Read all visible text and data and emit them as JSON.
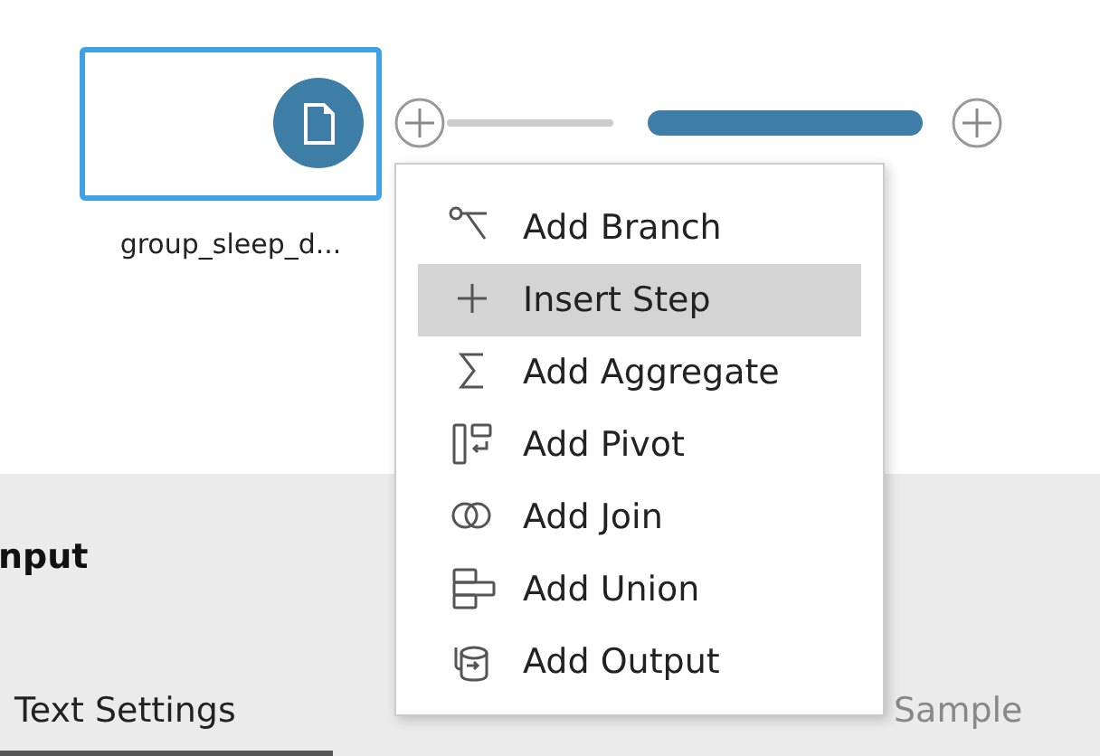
{
  "flow": {
    "node": {
      "label": "group_sleep_d...",
      "selected": true
    }
  },
  "menu": {
    "items": [
      {
        "kind": "branch",
        "label": "Add Branch",
        "selected": false
      },
      {
        "kind": "insert",
        "label": "Insert Step",
        "selected": true
      },
      {
        "kind": "aggregate",
        "label": "Add Aggregate",
        "selected": false
      },
      {
        "kind": "pivot",
        "label": "Add Pivot",
        "selected": false
      },
      {
        "kind": "join",
        "label": "Add Join",
        "selected": false
      },
      {
        "kind": "union",
        "label": "Add Union",
        "selected": false
      },
      {
        "kind": "output",
        "label": "Add Output",
        "selected": false
      }
    ]
  },
  "panel": {
    "title": "nput",
    "tabs": [
      {
        "label": "Text Settings",
        "selected": true
      },
      {
        "label": "Sample",
        "selected": false
      }
    ]
  }
}
